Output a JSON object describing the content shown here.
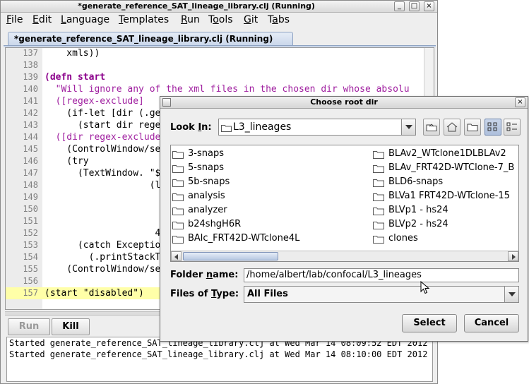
{
  "main_window": {
    "title": "*generate_reference_SAT_lineage_library.clj (Running)",
    "controls": [
      "_",
      "□",
      "×"
    ]
  },
  "menu": [
    {
      "pre": "",
      "u": "F",
      "post": "ile"
    },
    {
      "pre": "",
      "u": "E",
      "post": "dit"
    },
    {
      "pre": "",
      "u": "L",
      "post": "anguage"
    },
    {
      "pre": "",
      "u": "T",
      "post": "emplates"
    },
    {
      "pre": "",
      "u": "R",
      "post": "un"
    },
    {
      "pre": "T",
      "u": "o",
      "post": "ols"
    },
    {
      "pre": "",
      "u": "G",
      "post": "it"
    },
    {
      "pre": "T",
      "u": "a",
      "post": "bs"
    }
  ],
  "tab": {
    "label": "*generate_reference_SAT_lineage_library.clj (Running)"
  },
  "code": [
    {
      "n": "137",
      "text": "    xmls))"
    },
    {
      "n": "138",
      "text": ""
    },
    {
      "n": "139",
      "text": "(defn start"
    },
    {
      "n": "140",
      "text": "  \"Will ignore any of the xml files in the chosen dir whose absolu"
    },
    {
      "n": "141",
      "text": "  ([regex-exclude]"
    },
    {
      "n": "142",
      "text": "    (if-let [dir (.ge"
    },
    {
      "n": "143",
      "text": "      (start dir rege"
    },
    {
      "n": "144",
      "text": "  ([dir regex-exclude"
    },
    {
      "n": "145",
      "text": "    (ControlWindow/se"
    },
    {
      "n": "146",
      "text": "    (try"
    },
    {
      "n": "147",
      "text": "      (TextWindow. \"$"
    },
    {
      "n": "148",
      "text": "                   (l"
    },
    {
      "n": "149",
      "text": ""
    },
    {
      "n": "150",
      "text": ""
    },
    {
      "n": "151",
      "text": ""
    },
    {
      "n": "152",
      "text": "                    4"
    },
    {
      "n": "153",
      "text": "      (catch Exceptio"
    },
    {
      "n": "154",
      "text": "        (.printStackT"
    },
    {
      "n": "155",
      "text": "    (ControlWindow/se"
    },
    {
      "n": "156",
      "text": ""
    },
    {
      "n": "157",
      "text": "(start \"disabled\")"
    }
  ],
  "run_controls": {
    "run_label": "Run",
    "kill_label": "Kill"
  },
  "console": [
    "Started generate_reference_SAT_lineage_library.clj at Wed Mar 14 08:09:52 EDT 2012",
    "Started generate_reference_SAT_lineage_library.clj at Wed Mar 14 08:10:00 EDT 2012"
  ],
  "dialog": {
    "title": "Choose root dir",
    "look_in_label_pre": "Look ",
    "look_in_label_u": "I",
    "look_in_label_post": "n:",
    "look_in_value": "L3_lineages",
    "files_col1": [
      "3-snaps",
      "5-snaps",
      "5b-snaps",
      "analysis",
      "analyzer",
      "b24shgH6R",
      "BAlc_FRT42D-WTclone4L"
    ],
    "files_col2": [
      "BLAv2_WTclone1DLBLAv2",
      "BLAv_FRT42D-WTClone-7_B",
      "BLD6-snaps",
      "BLVa1 FRT42D-WTclone-15",
      "BLVp1 - hs24",
      "BLVp2 - hs24",
      "clones"
    ],
    "folder_name_label_pre": "Folder ",
    "folder_name_label_u": "n",
    "folder_name_label_post": "ame:",
    "folder_name_value": "/home/albert/lab/confocal/L3_lineages",
    "files_type_label_pre": "Files of ",
    "files_type_label_u": "T",
    "files_type_label_post": "ype:",
    "files_type_value": "All Files",
    "select_label": "Select",
    "cancel_label": "Cancel"
  },
  "colors": {
    "keyword": "#8b008b",
    "string": "#a020a0",
    "current_line": "#ffffa8",
    "tab_bg": "#c9d6ea"
  }
}
